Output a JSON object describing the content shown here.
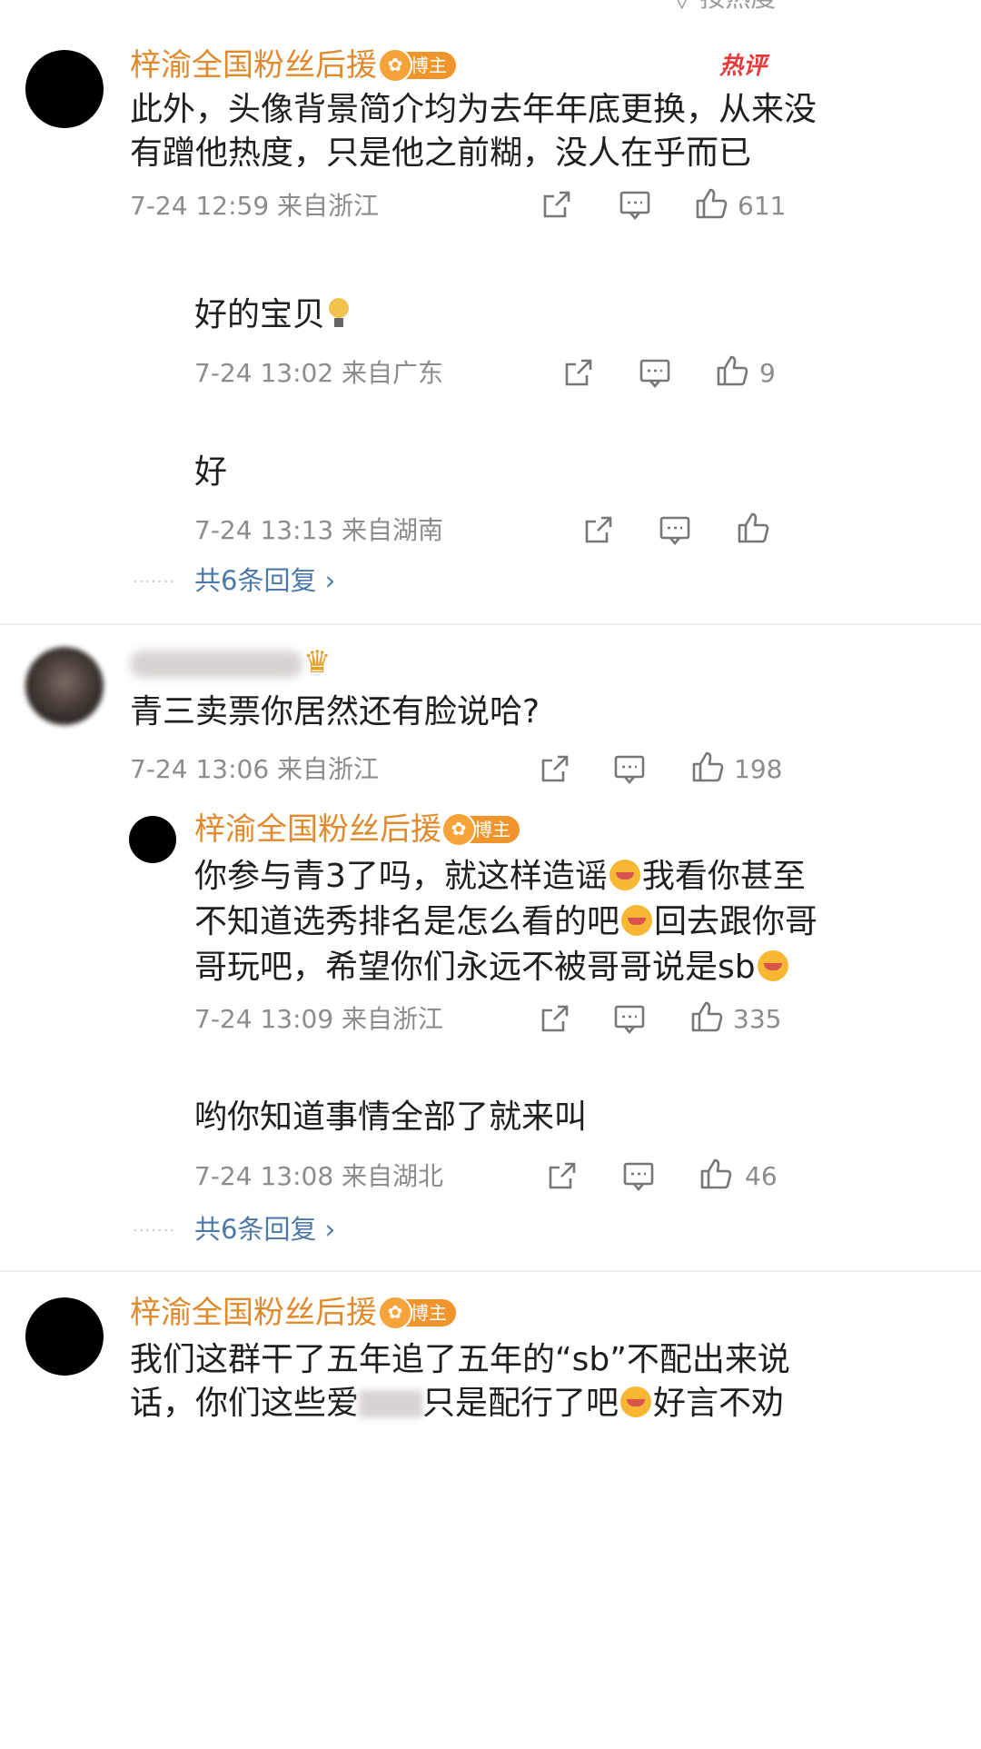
{
  "top_partial_text": "▽ 按热度",
  "reply_icons": {
    "share": "share-icon",
    "comment": "comment-icon",
    "like": "thumbs-up-icon"
  },
  "comments": [
    {
      "author": "梓渝全国粉丝后援会",
      "badge": "博主",
      "hot_tag": "热评",
      "lines": [
        "此外，头像背景简介均为去年年底更换，从来没",
        "有蹭他热度，只是他之前糊，没人在乎而已"
      ],
      "meta": "7-24 12:59 来自浙江",
      "likes": "611",
      "replies": [
        {
          "text": "好的宝贝",
          "meta": "7-24 13:02 来自广东",
          "likes": "9"
        },
        {
          "text": "好",
          "meta": "7-24 13:13 来自湖南",
          "likes": ""
        }
      ],
      "more_replies": "共6条回复 ›"
    },
    {
      "author": "",
      "lines": [
        "青三卖票你居然还有脸说哈?"
      ],
      "meta": "7-24 13:06 来自浙江",
      "likes": "198",
      "replies": [
        {
          "author": "梓渝全国粉丝后援会",
          "badge": "博主",
          "lines": [
            "你参与青3了吗，就这样造谣",
            "我看你甚至",
            "不知道选秀排名是怎么看的吧",
            "回去跟你哥",
            "哥玩吧，希望你们永远不被哥哥说是sb"
          ],
          "meta": "7-24 13:09 来自浙江",
          "likes": "335"
        },
        {
          "text": "哟你知道事情全部了就来叫",
          "meta": "7-24 13:08 来自湖北",
          "likes": "46"
        }
      ],
      "more_replies": "共6条回复 ›"
    },
    {
      "author": "梓渝全国粉丝后援会",
      "badge": "博主",
      "lines": [
        "我们这群干了五年追了五年的“sb”不配出来说",
        "话，你们这些爱",
        "只是配行了吧",
        "好言不劝"
      ]
    }
  ],
  "more_dots": "·······"
}
